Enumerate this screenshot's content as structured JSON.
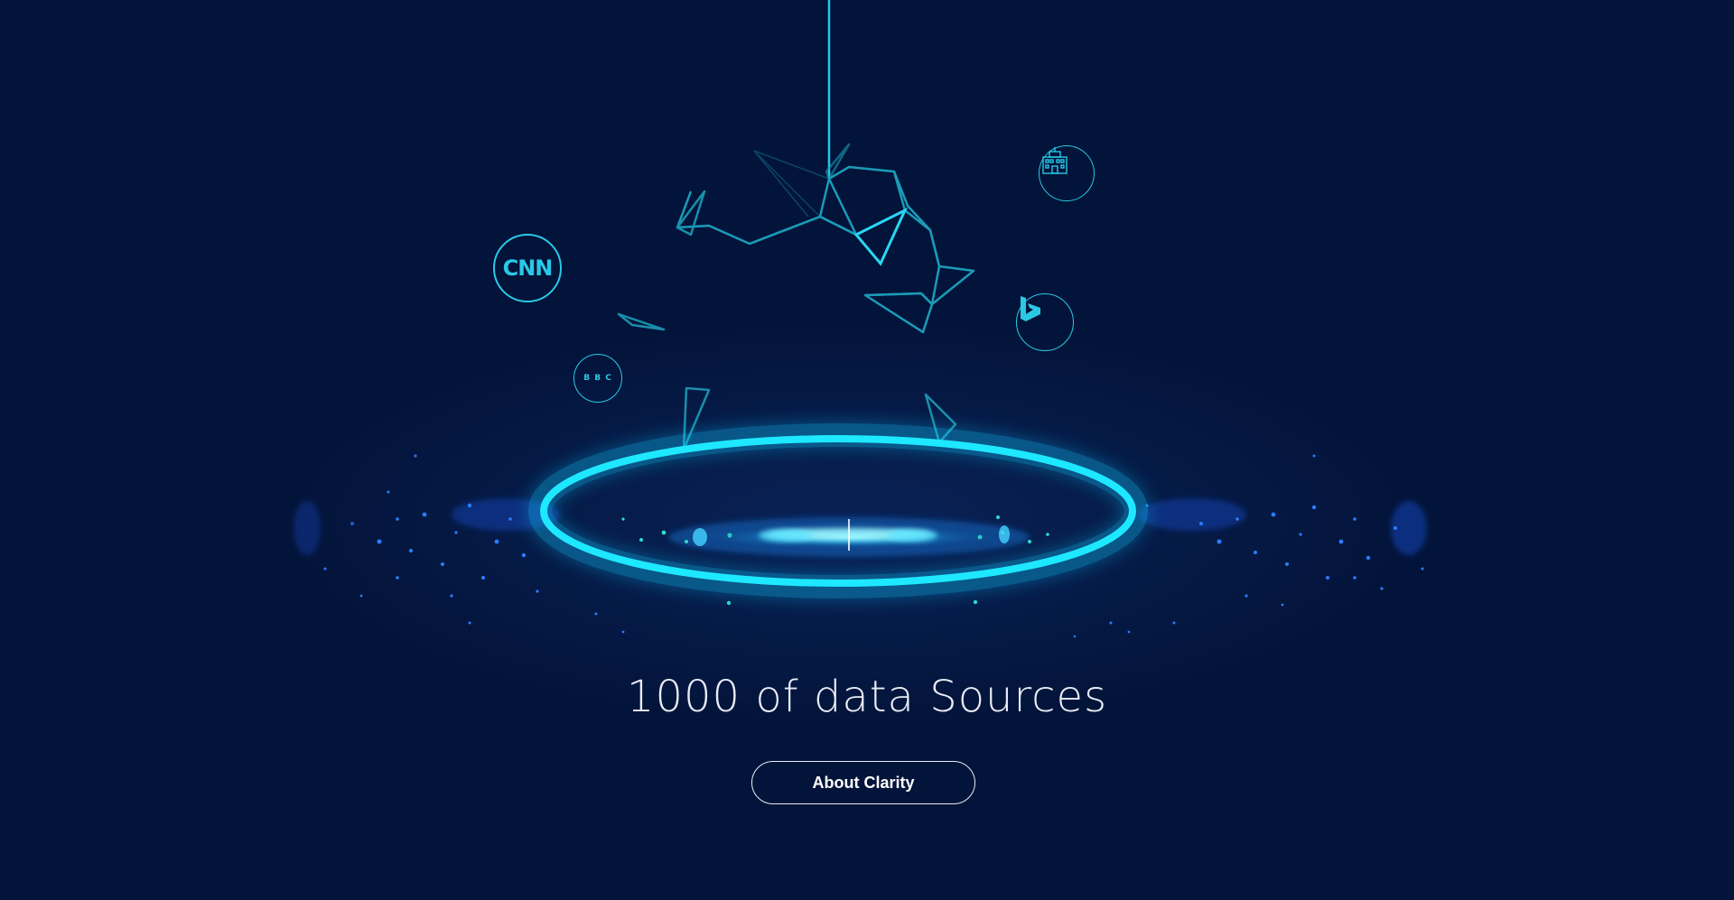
{
  "hero": {
    "headline": "1000 of data Sources",
    "cta_label": "About Clarity"
  },
  "sources": [
    {
      "name": "CNN",
      "icon": "cnn-logo-icon",
      "label": "CNN"
    },
    {
      "name": "BBC",
      "icon": "bbc-logo-icon",
      "label": "B B C"
    },
    {
      "name": "Bing",
      "icon": "bing-logo-icon"
    },
    {
      "name": "Building",
      "icon": "building-icon"
    }
  ],
  "colors": {
    "background": "#03143a",
    "accent": "#29c9e6",
    "ring": "#1ee8ff",
    "text": "#e8ecf5"
  }
}
